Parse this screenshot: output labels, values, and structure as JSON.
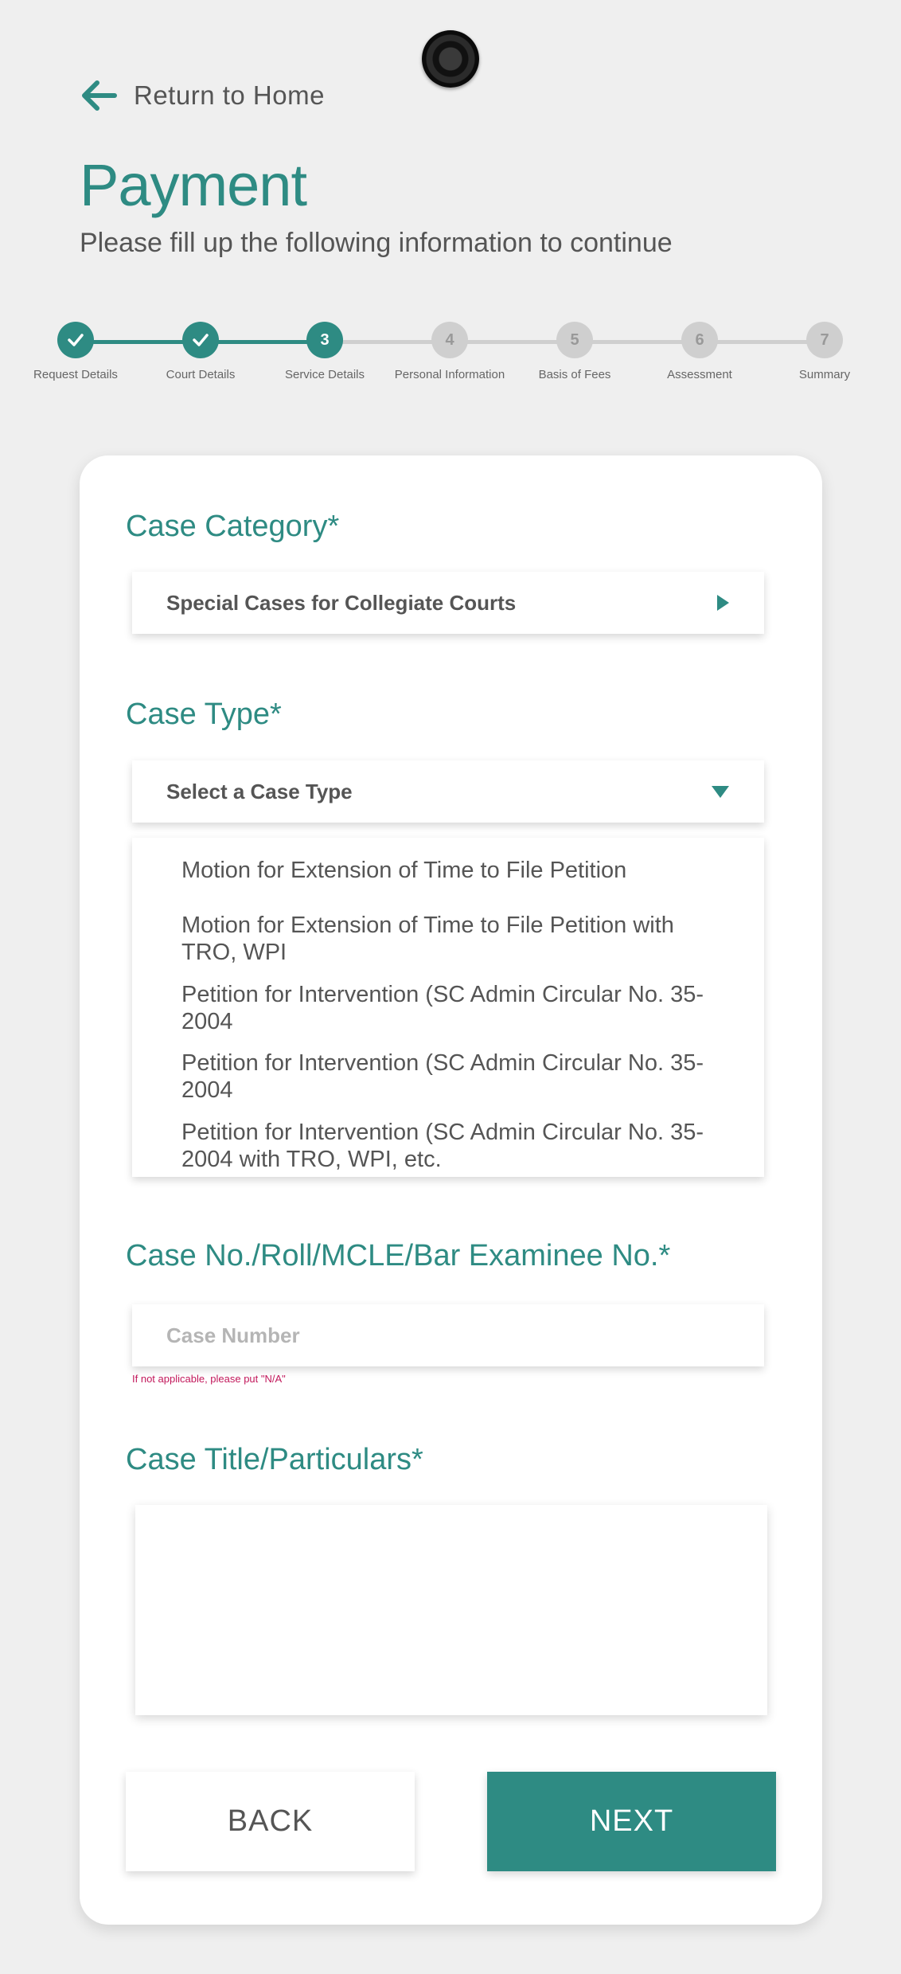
{
  "nav": {
    "return_label": "Return to Home"
  },
  "header": {
    "title": "Payment",
    "subtitle": "Please fill up the following information to continue"
  },
  "stepper": {
    "steps": [
      {
        "number": "1",
        "label": "Request Details",
        "state": "done"
      },
      {
        "number": "2",
        "label": "Court Details",
        "state": "done"
      },
      {
        "number": "3",
        "label": "Service Details",
        "state": "active"
      },
      {
        "number": "4",
        "label": "Personal Information",
        "state": "pending"
      },
      {
        "number": "5",
        "label": "Basis of Fees",
        "state": "pending"
      },
      {
        "number": "6",
        "label": "Assessment",
        "state": "pending"
      },
      {
        "number": "7",
        "label": "Summary",
        "state": "pending"
      }
    ]
  },
  "form": {
    "case_category": {
      "label": "Case Category*",
      "value": "Special Cases for Collegiate Courts"
    },
    "case_type": {
      "label": "Case Type*",
      "value": "Select a Case Type",
      "options": [
        "Motion for Extension of Time to File Petition",
        "Motion for Extension of Time to File Petition with TRO, WPI",
        "Petition for Intervention (SC Admin Circular No. 35-2004",
        "Petition for Intervention (SC Admin Circular No. 35-2004",
        "Petition for Intervention (SC Admin Circular No. 35-2004 with TRO, WPI, etc."
      ]
    },
    "case_number": {
      "label": "Case No./Roll/MCLE/Bar Examinee No.*",
      "placeholder": "Case Number",
      "value": "",
      "hint": "If not applicable, please put \"N/A\""
    },
    "case_title": {
      "label": "Case Title/Particulars*",
      "value": ""
    }
  },
  "buttons": {
    "back": "BACK",
    "next": "NEXT"
  },
  "colors": {
    "accent": "#2e8b83",
    "background": "#efefef",
    "hint": "#c2185b"
  }
}
